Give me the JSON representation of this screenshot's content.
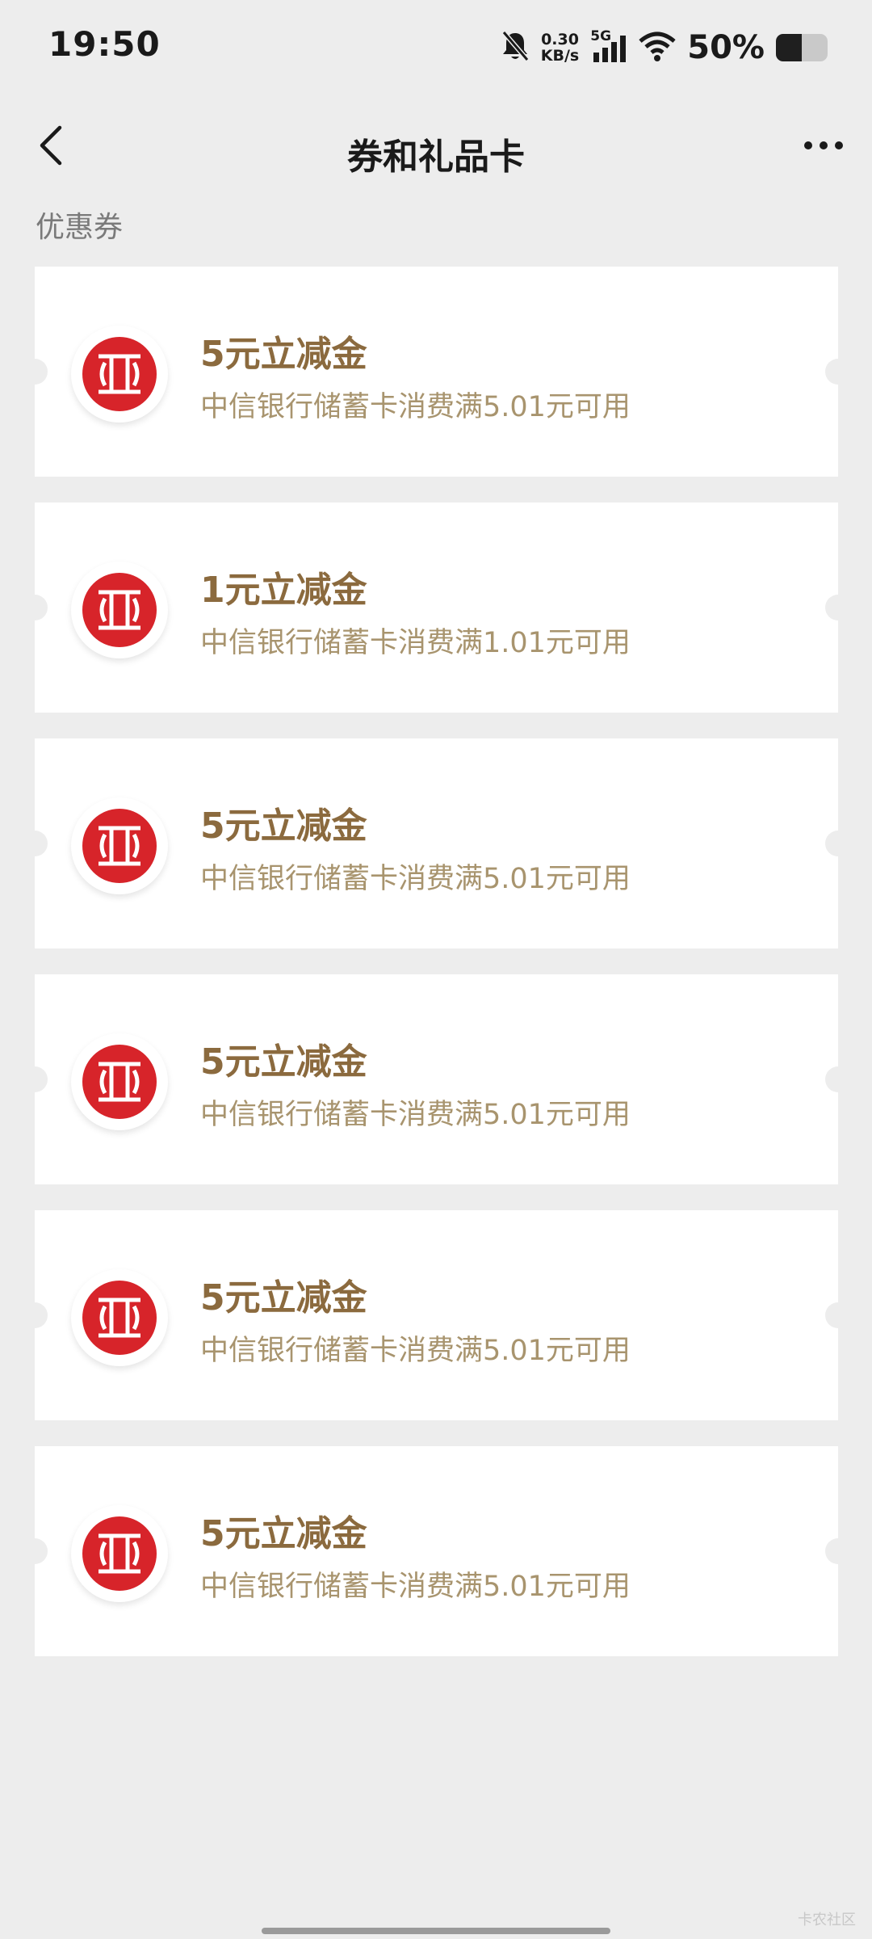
{
  "status_bar": {
    "time": "19:50",
    "net_speed_value": "0.30",
    "net_speed_unit": "KB/s",
    "network_type": "5G",
    "battery_percent": "50%",
    "battery_level": 0.5
  },
  "header": {
    "title": "券和礼品卡",
    "back_icon": "chevron-left-icon",
    "more_icon": "more-dots-icon"
  },
  "section": {
    "label": "优惠券"
  },
  "colors": {
    "coupon_title": "#8b6a3e",
    "coupon_desc": "#a8946e",
    "bank_red": "#d7242a",
    "background": "#ededed"
  },
  "coupons": [
    {
      "title": "5元立减金",
      "desc": "中信银行储蓄卡消费满5.01元可用",
      "icon": "citic-bank-logo-icon"
    },
    {
      "title": "1元立减金",
      "desc": "中信银行储蓄卡消费满1.01元可用",
      "icon": "citic-bank-logo-icon"
    },
    {
      "title": "5元立减金",
      "desc": "中信银行储蓄卡消费满5.01元可用",
      "icon": "citic-bank-logo-icon"
    },
    {
      "title": "5元立减金",
      "desc": "中信银行储蓄卡消费满5.01元可用",
      "icon": "citic-bank-logo-icon"
    },
    {
      "title": "5元立减金",
      "desc": "中信银行储蓄卡消费满5.01元可用",
      "icon": "citic-bank-logo-icon"
    },
    {
      "title": "5元立减金",
      "desc": "中信银行储蓄卡消费满5.01元可用",
      "icon": "citic-bank-logo-icon"
    }
  ],
  "watermark": "卡农社区"
}
